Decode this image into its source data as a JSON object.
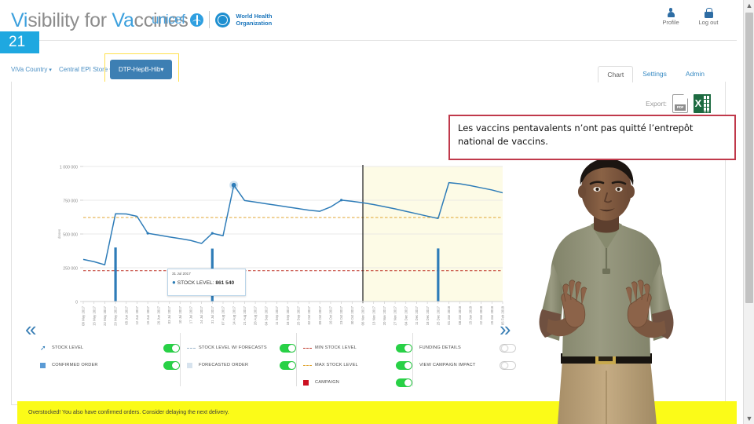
{
  "slide": {
    "number": "21"
  },
  "header": {
    "brand_prefix": "Vi",
    "brand_mid": "sibility for ",
    "brand_hl2": "Va",
    "brand_suffix": "ccines",
    "unicef_label": "unicef",
    "who_line1": "World Health",
    "who_line2": "Organization",
    "actions": [
      {
        "label": "Profile",
        "icon": "person-icon"
      },
      {
        "label": "Log out",
        "icon": "lock-icon"
      }
    ]
  },
  "breadcrumb": {
    "level1": "ViVa Country",
    "level2": "Central EPI Store",
    "level3": "DTP-HepB-Hib",
    "caret": "▾"
  },
  "tabs": [
    {
      "label": "Chart",
      "active": true
    },
    {
      "label": "Settings",
      "active": false
    },
    {
      "label": "Admin",
      "active": false
    }
  ],
  "export": {
    "label": "Export:",
    "pdf_tag": "PDF",
    "xls_letter": "X"
  },
  "tooltip": {
    "date": "31 Jul 2017",
    "series": "STOCK LEVEL:",
    "value": "861 540"
  },
  "nav": {
    "prev": "«",
    "next": "»"
  },
  "legend_columns": [
    {
      "items": [
        {
          "label": "STOCK LEVEL",
          "symbol": "marker",
          "color": "#2e7cb8",
          "toggle": "on"
        },
        {
          "label": "CONFIRMED ORDER",
          "symbol": "square",
          "color": "#5b9bd5",
          "toggle": "on"
        }
      ]
    },
    {
      "items": [
        {
          "label": "STOCK LEVEL W/ FORECASTS",
          "symbol": "dash",
          "color": "#9fb8cc",
          "toggle": "on"
        },
        {
          "label": "FORECASTED ORDER",
          "symbol": "square",
          "color": "#d7e3ee",
          "toggle": "on"
        }
      ]
    },
    {
      "items": [
        {
          "label": "MIN STOCK LEVEL",
          "symbol": "dash",
          "color": "#c0392b",
          "toggle": "on"
        },
        {
          "label": "MAX STOCK LEVEL",
          "symbol": "dash",
          "color": "#e0a530",
          "toggle": "on"
        },
        {
          "label": "CAMPAIGN",
          "symbol": "square",
          "color": "#cc1122",
          "toggle": "on"
        }
      ]
    },
    {
      "items": [
        {
          "label": "FUNDING DETAILS",
          "symbol": "none",
          "color": "",
          "toggle": "off"
        },
        {
          "label": "VIEW CAMPAIGN IMPACT",
          "symbol": "none",
          "color": "",
          "toggle": "off"
        }
      ]
    }
  ],
  "warning": {
    "text": "Overstocked! You also have confirmed orders. Consider delaying the next delivery."
  },
  "callout": {
    "text": "Les vaccins pentavalents n’ont pas quitté l’entrepôt national de vaccins."
  },
  "chart_data": {
    "type": "line",
    "title": "",
    "xlabel": "",
    "ylabel": "doses",
    "ylim": [
      0,
      1000000
    ],
    "yticks": [
      0,
      250000,
      500000,
      750000,
      1000000
    ],
    "ytick_labels": [
      "0",
      "250 000",
      "500 000",
      "750 000",
      "1 000 000"
    ],
    "grid": true,
    "legend_position": "below",
    "forecast_band_start_index": 26,
    "today_line_index": 26,
    "categories": [
      "08 May 2017",
      "15 May 2017",
      "22 May 2017",
      "29 May 2017",
      "05 Jun 2017",
      "12 Jun 2017",
      "19 Jun 2017",
      "26 Jun 2017",
      "03 Jul 2017",
      "10 Jul 2017",
      "17 Jul 2017",
      "24 Jul 2017",
      "31 Jul 2017",
      "07 Aug 2017",
      "14 Aug 2017",
      "21 Aug 2017",
      "28 Aug 2017",
      "04 Sep 2017",
      "11 Sep 2017",
      "18 Sep 2017",
      "25 Sep 2017",
      "02 Oct 2017",
      "09 Oct 2017",
      "16 Oct 2017",
      "23 Oct 2017",
      "30 Oct 2017",
      "06 Nov 2017",
      "13 Nov 2017",
      "20 Nov 2017",
      "27 Nov 2017",
      "04 Dec 2017",
      "11 Dec 2017",
      "18 Dec 2017",
      "25 Dec 2017",
      "01 Jan 2018",
      "08 Jan 2018",
      "15 Jan 2018",
      "22 Jan 2018",
      "29 Jan 2018",
      "05 Feb 2018"
    ],
    "series": [
      {
        "name": "STOCK LEVEL",
        "type": "line",
        "color": "#2e7cb8",
        "values": [
          312000,
          295000,
          272000,
          650000,
          648000,
          631000,
          505000,
          492000,
          478000,
          466000,
          452000,
          430000,
          505000,
          487000,
          861540,
          748000,
          736000,
          724000,
          712000,
          700000,
          688000,
          676000,
          668000,
          700000,
          751000,
          742000,
          731000,
          718000,
          702000,
          686000,
          668000,
          650000,
          632000,
          615000,
          880000,
          872000,
          858000,
          842000,
          826000,
          805000
        ]
      },
      {
        "name": "CONFIRMED ORDER",
        "type": "bar",
        "color": "#2e7cb8",
        "points": [
          {
            "index": 3,
            "value": 400000
          },
          {
            "index": 12,
            "value": 392000
          },
          {
            "index": 33,
            "value": 393000
          }
        ]
      },
      {
        "name": "MIN STOCK LEVEL",
        "type": "hline",
        "color": "#c0392b",
        "value": 228000
      },
      {
        "name": "MAX STOCK LEVEL",
        "type": "hline",
        "color": "#e0a530",
        "value": 622000
      }
    ]
  }
}
